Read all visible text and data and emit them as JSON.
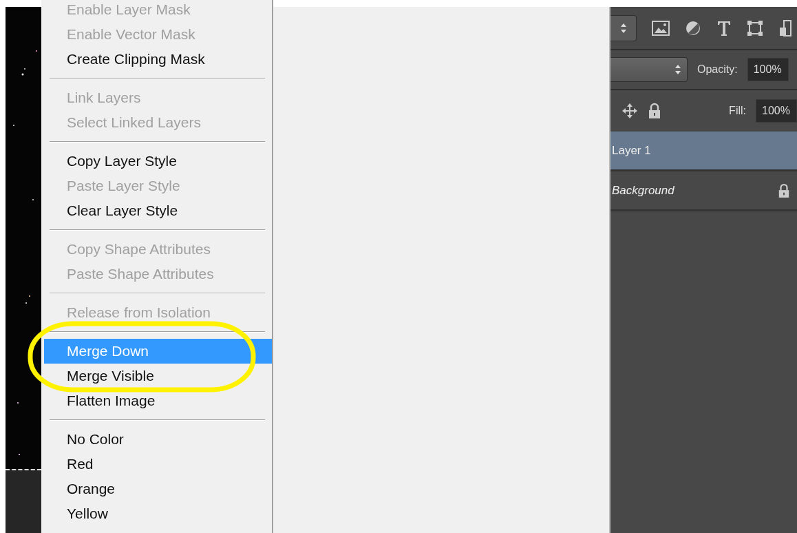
{
  "context_menu": {
    "groups": [
      {
        "items": [
          {
            "label": "Enable Layer Mask",
            "disabled": true,
            "selected": false
          },
          {
            "label": "Enable Vector Mask",
            "disabled": true,
            "selected": false
          },
          {
            "label": "Create Clipping Mask",
            "disabled": false,
            "selected": false
          }
        ]
      },
      {
        "items": [
          {
            "label": "Link Layers",
            "disabled": true,
            "selected": false
          },
          {
            "label": "Select Linked Layers",
            "disabled": true,
            "selected": false
          }
        ]
      },
      {
        "items": [
          {
            "label": "Copy Layer Style",
            "disabled": false,
            "selected": false
          },
          {
            "label": "Paste Layer Style",
            "disabled": true,
            "selected": false
          },
          {
            "label": "Clear Layer Style",
            "disabled": false,
            "selected": false
          }
        ]
      },
      {
        "items": [
          {
            "label": "Copy Shape Attributes",
            "disabled": true,
            "selected": false
          },
          {
            "label": "Paste Shape Attributes",
            "disabled": true,
            "selected": false
          }
        ]
      },
      {
        "items": [
          {
            "label": "Release from Isolation",
            "disabled": true,
            "selected": false
          }
        ]
      },
      {
        "items": [
          {
            "label": "Merge Down",
            "disabled": false,
            "selected": true
          },
          {
            "label": "Merge Visible",
            "disabled": false,
            "selected": false
          },
          {
            "label": "Flatten Image",
            "disabled": false,
            "selected": false
          }
        ]
      },
      {
        "items": [
          {
            "label": "No Color",
            "disabled": false,
            "selected": false
          },
          {
            "label": "Red",
            "disabled": false,
            "selected": false
          },
          {
            "label": "Orange",
            "disabled": false,
            "selected": false
          },
          {
            "label": "Yellow",
            "disabled": false,
            "selected": false
          }
        ]
      }
    ]
  },
  "layers_panel": {
    "opacity": {
      "label": "Opacity:",
      "value": "100%"
    },
    "fill": {
      "label": "Fill:",
      "value": "100%"
    },
    "layers": [
      {
        "name": "Layer 1",
        "kind": "normal",
        "selected": true,
        "locked": false
      },
      {
        "name": "Background",
        "kind": "background",
        "selected": false,
        "locked": true
      }
    ]
  }
}
